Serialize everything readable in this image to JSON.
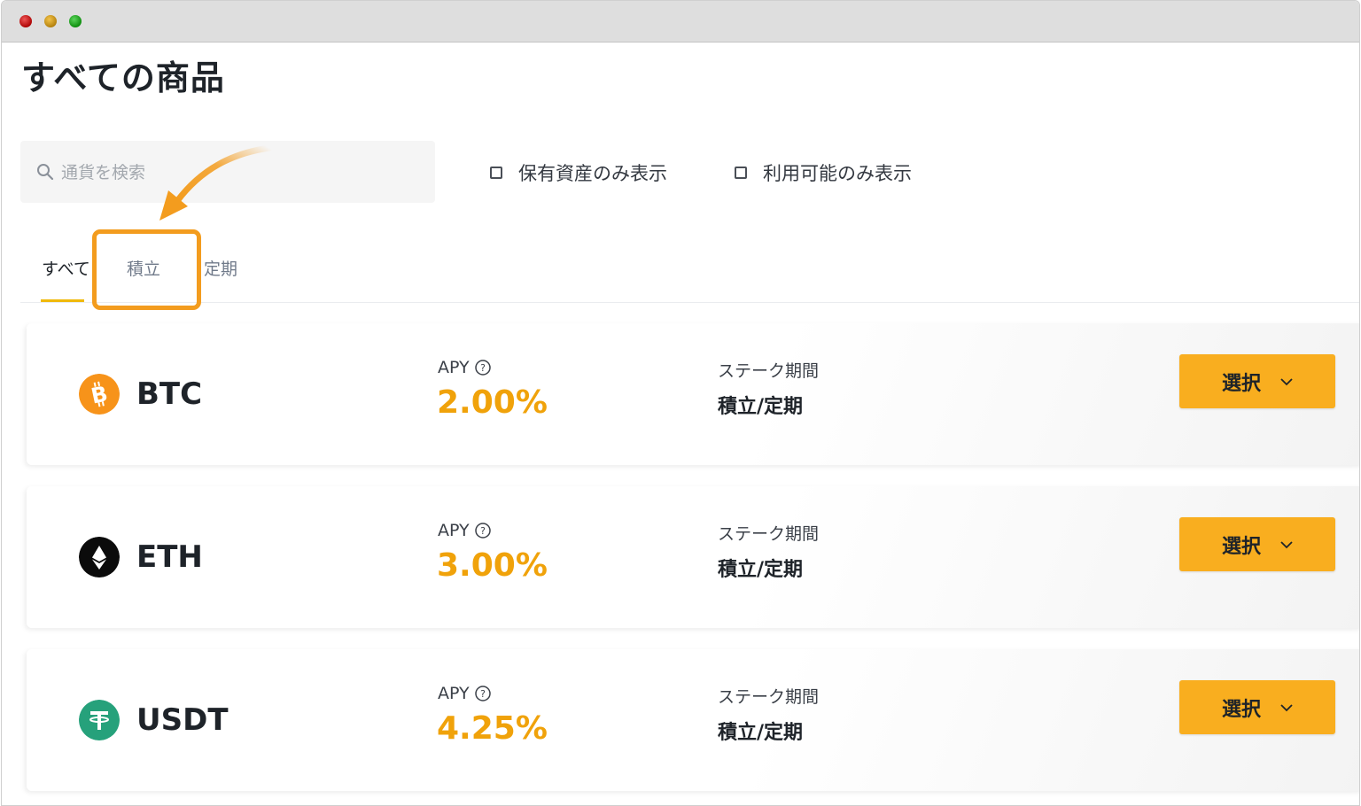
{
  "page": {
    "title": "すべての商品"
  },
  "search": {
    "placeholder": "通貨を検索"
  },
  "filters": [
    {
      "label": "保有資産のみ表示",
      "checked": false
    },
    {
      "label": "利用可能のみ表示",
      "checked": false
    }
  ],
  "tabs": [
    {
      "label": "すべて",
      "active": true
    },
    {
      "label": "積立",
      "active": false,
      "highlighted": true
    },
    {
      "label": "定期",
      "active": false
    }
  ],
  "products": [
    {
      "coin": "BTC",
      "icon": "bitcoin-icon",
      "icon_color": "#f7931a",
      "apy_label": "APY",
      "apy": "2.00%",
      "term_label": "ステーク期間",
      "term": "積立/定期",
      "button_label": "選択"
    },
    {
      "coin": "ETH",
      "icon": "ethereum-icon",
      "icon_color": "#0b0b0b",
      "apy_label": "APY",
      "apy": "3.00%",
      "term_label": "ステーク期間",
      "term": "積立/定期",
      "button_label": "選択"
    },
    {
      "coin": "USDT",
      "icon": "tether-icon",
      "icon_color": "#26a17b",
      "apy_label": "APY",
      "apy": "4.25%",
      "term_label": "ステーク期間",
      "term": "積立/定期",
      "button_label": "選択"
    }
  ],
  "colors": {
    "accent": "#f0b90b",
    "button": "#f9ae1f",
    "apy": "#f0a20a",
    "highlight": "#f39c1e"
  }
}
